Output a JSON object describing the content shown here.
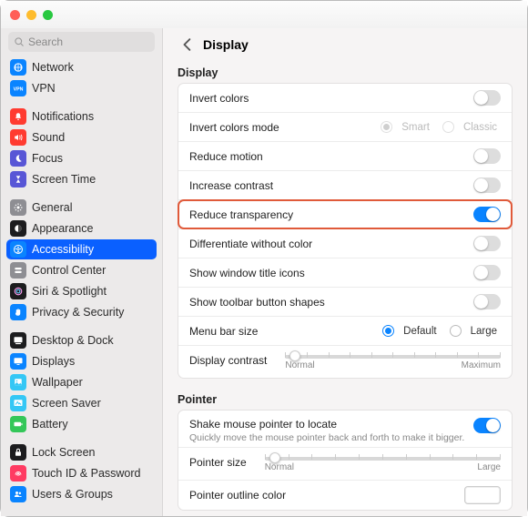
{
  "search": {
    "placeholder": "Search"
  },
  "sidebar": {
    "items": [
      {
        "label": "Network",
        "icon": "globe-icon",
        "bg": "#0a84ff"
      },
      {
        "label": "VPN",
        "icon": "vpn-icon",
        "bg": "#0a84ff"
      },
      {
        "spacer": true
      },
      {
        "label": "Notifications",
        "icon": "bell-icon",
        "bg": "#ff3b30"
      },
      {
        "label": "Sound",
        "icon": "speaker-icon",
        "bg": "#ff3b30"
      },
      {
        "label": "Focus",
        "icon": "moon-icon",
        "bg": "#5856d6"
      },
      {
        "label": "Screen Time",
        "icon": "hourglass-icon",
        "bg": "#5856d6"
      },
      {
        "spacer": true
      },
      {
        "label": "General",
        "icon": "gear-icon",
        "bg": "#8e8e93"
      },
      {
        "label": "Appearance",
        "icon": "appearance-icon",
        "bg": "#1c1c1e"
      },
      {
        "label": "Accessibility",
        "icon": "accessibility-icon",
        "bg": "#0a84ff",
        "selected": true
      },
      {
        "label": "Control Center",
        "icon": "switches-icon",
        "bg": "#8e8e93"
      },
      {
        "label": "Siri & Spotlight",
        "icon": "siri-icon",
        "bg": "#1c1c1e"
      },
      {
        "label": "Privacy & Security",
        "icon": "hand-icon",
        "bg": "#0a84ff"
      },
      {
        "spacer": true
      },
      {
        "label": "Desktop & Dock",
        "icon": "dock-icon",
        "bg": "#1c1c1e"
      },
      {
        "label": "Displays",
        "icon": "display-icon",
        "bg": "#0a84ff"
      },
      {
        "label": "Wallpaper",
        "icon": "wallpaper-icon",
        "bg": "#34c7f5"
      },
      {
        "label": "Screen Saver",
        "icon": "screensaver-icon",
        "bg": "#34c7f5"
      },
      {
        "label": "Battery",
        "icon": "battery-icon",
        "bg": "#34c759"
      },
      {
        "spacer": true
      },
      {
        "label": "Lock Screen",
        "icon": "lock-icon",
        "bg": "#1c1c1e"
      },
      {
        "label": "Touch ID & Password",
        "icon": "fingerprint-icon",
        "bg": "#ff3b62"
      },
      {
        "label": "Users & Groups",
        "icon": "users-icon",
        "bg": "#0a84ff"
      }
    ]
  },
  "main": {
    "title": "Display",
    "sections": {
      "display": {
        "title": "Display",
        "invert_colors": "Invert colors",
        "invert_mode": {
          "label": "Invert colors mode",
          "smart": "Smart",
          "classic": "Classic"
        },
        "reduce_motion": "Reduce motion",
        "increase_contrast": "Increase contrast",
        "reduce_transparency": "Reduce transparency",
        "diff_without_color": "Differentiate without color",
        "show_title_icons": "Show window title icons",
        "show_toolbar_shapes": "Show toolbar button shapes",
        "menubar_size": {
          "label": "Menu bar size",
          "default": "Default",
          "large": "Large"
        },
        "display_contrast": {
          "label": "Display contrast",
          "min": "Normal",
          "max": "Maximum"
        }
      },
      "pointer": {
        "title": "Pointer",
        "shake": {
          "label": "Shake mouse pointer to locate",
          "sub": "Quickly move the mouse pointer back and forth to make it bigger."
        },
        "pointer_size": {
          "label": "Pointer size",
          "min": "Normal",
          "max": "Large"
        },
        "outline_color": "Pointer outline color"
      }
    },
    "state": {
      "invert_colors": false,
      "invert_mode": "smart",
      "reduce_motion": false,
      "increase_contrast": false,
      "reduce_transparency": true,
      "diff_without_color": false,
      "show_title_icons": false,
      "show_toolbar_shapes": false,
      "menubar_size": "default",
      "display_contrast_pct": 2,
      "shake": true,
      "pointer_size_pct": 2,
      "outline_color": "#ffffff"
    }
  }
}
